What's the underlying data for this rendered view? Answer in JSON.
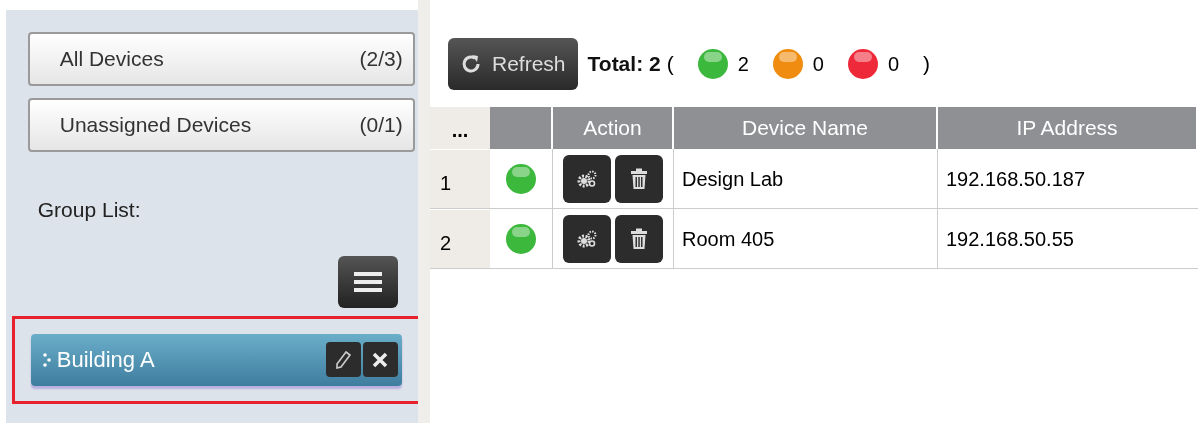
{
  "sidebar": {
    "filters": [
      {
        "label": "All Devices",
        "count": "(2/3)"
      },
      {
        "label": "Unassigned Devices",
        "count": "(0/1)"
      }
    ],
    "group_list_label": "Group List:",
    "groups": [
      {
        "name": "Building A",
        "highlighted": true
      }
    ]
  },
  "toolbar": {
    "refresh_label": "Refresh",
    "total_label": "Total: 2",
    "open_paren": "(",
    "close_paren": ")",
    "status_counts": [
      {
        "color": "#3cb83c",
        "count": "2"
      },
      {
        "color": "#f08c10",
        "count": "0"
      },
      {
        "color": "#ee2a3a",
        "count": "0"
      }
    ]
  },
  "table": {
    "columns": [
      "...",
      "",
      "Action",
      "Device Name",
      "IP Address"
    ],
    "rows": [
      {
        "index": "1",
        "color": "#3cb83c",
        "device_name": "Design Lab",
        "ip_address": "192.168.50.187"
      },
      {
        "index": "2",
        "color": "#3cb83c",
        "device_name": "Room 405",
        "ip_address": "192.168.50.55"
      }
    ]
  }
}
